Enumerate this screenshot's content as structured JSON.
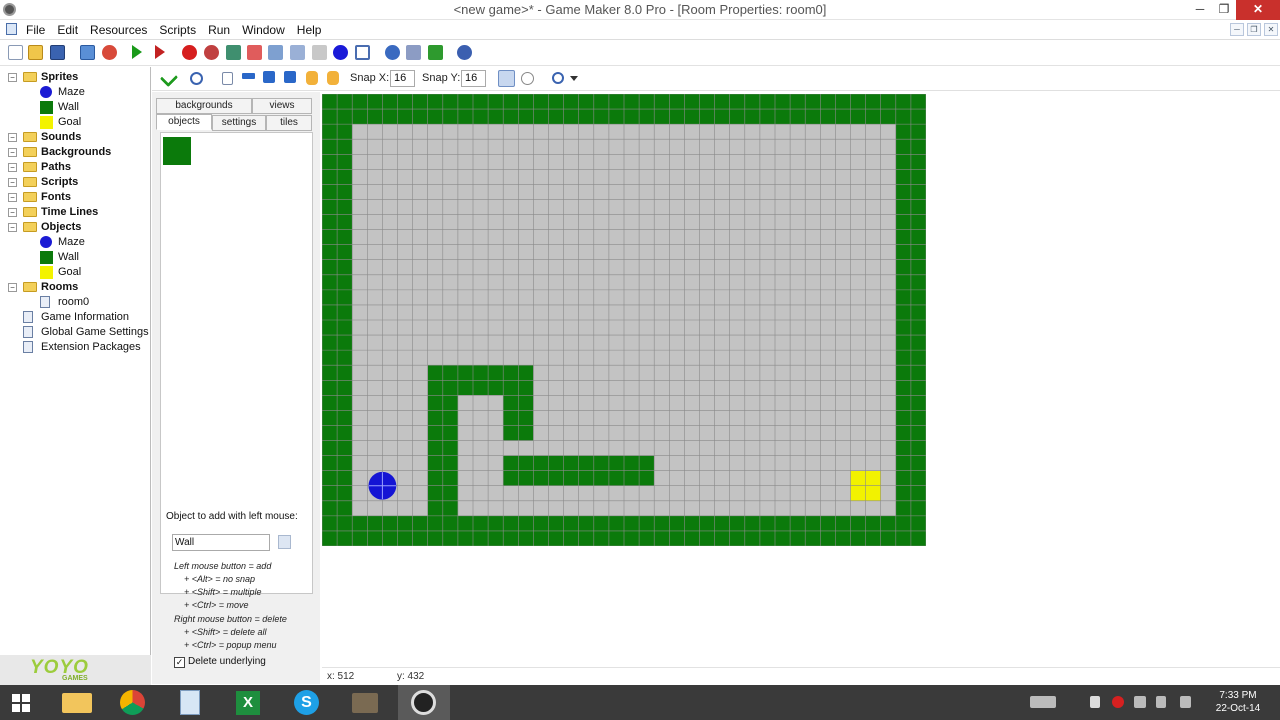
{
  "window": {
    "title": "<new game>* - Game Maker 8.0 Pro - [Room Properties: room0]"
  },
  "menu": [
    "File",
    "Edit",
    "Resources",
    "Scripts",
    "Run",
    "Window",
    "Help"
  ],
  "tree": {
    "items": [
      {
        "label": "Sprites",
        "kind": "folder",
        "bold": true,
        "indent": 0
      },
      {
        "label": "Maze",
        "kind": "circle",
        "indent": 1
      },
      {
        "label": "Wall",
        "kind": "green",
        "indent": 1
      },
      {
        "label": "Goal",
        "kind": "yellow",
        "indent": 1
      },
      {
        "label": "Sounds",
        "kind": "folder",
        "bold": true,
        "indent": 0
      },
      {
        "label": "Backgrounds",
        "kind": "folder",
        "bold": true,
        "indent": 0
      },
      {
        "label": "Paths",
        "kind": "folder",
        "bold": true,
        "indent": 0
      },
      {
        "label": "Scripts",
        "kind": "folder",
        "bold": true,
        "indent": 0
      },
      {
        "label": "Fonts",
        "kind": "folder",
        "bold": true,
        "indent": 0
      },
      {
        "label": "Time Lines",
        "kind": "folder",
        "bold": true,
        "indent": 0
      },
      {
        "label": "Objects",
        "kind": "folder",
        "bold": true,
        "indent": 0
      },
      {
        "label": "Maze",
        "kind": "circle",
        "indent": 1
      },
      {
        "label": "Wall",
        "kind": "green",
        "indent": 1
      },
      {
        "label": "Goal",
        "kind": "yellow",
        "indent": 1
      },
      {
        "label": "Rooms",
        "kind": "folder",
        "bold": true,
        "indent": 0
      },
      {
        "label": "room0",
        "kind": "doc",
        "indent": 1
      },
      {
        "label": "Game Information",
        "kind": "doc",
        "indent": 0
      },
      {
        "label": "Global Game Settings",
        "kind": "doc",
        "indent": 0
      },
      {
        "label": "Extension Packages",
        "kind": "doc",
        "indent": 0
      }
    ]
  },
  "logo": {
    "main": "YOYO",
    "sub": "GAMES"
  },
  "roomToolbar": {
    "snap_x_label": "Snap X:",
    "snap_x_value": "16",
    "snap_y_label": "Snap Y:",
    "snap_y_value": "16"
  },
  "tabs": {
    "backgrounds": "backgrounds",
    "views": "views",
    "objects": "objects",
    "settings": "settings",
    "tiles": "tiles"
  },
  "panel": {
    "add_label": "Object to add with left mouse:",
    "object_value": "Wall",
    "help_lines": [
      "Left mouse button = add",
      "+ <Alt> = no snap",
      "+ <Shift> = multiple",
      "+ <Ctrl> = move",
      "Right mouse button = delete",
      "+ <Shift> = delete all",
      "+ <Ctrl> = popup menu"
    ],
    "delete_underlying": "Delete underlying",
    "delete_checked": true
  },
  "room": {
    "cols": 40,
    "rows": 30,
    "colors": {
      "wall": "#0b7a0b",
      "floor": "#c3c3c3",
      "grid": "#8a8a8a",
      "player": "#1414d4",
      "goal": "#f2f200"
    },
    "walls": [
      [
        0,
        0,
        40,
        2
      ],
      [
        0,
        28,
        40,
        2
      ],
      [
        0,
        2,
        2,
        26
      ],
      [
        38,
        2,
        2,
        26
      ],
      [
        7,
        18,
        7,
        2
      ],
      [
        7,
        20,
        2,
        8
      ],
      [
        12,
        20,
        2,
        3
      ],
      [
        12,
        24,
        10,
        2
      ]
    ],
    "player": {
      "col": 3,
      "row": 25
    },
    "goal": {
      "col": 35,
      "row": 25
    }
  },
  "status": {
    "x": "x: 512",
    "y": "y: 432"
  },
  "clock": {
    "time": "7:33 PM",
    "date": "22-Oct-14"
  }
}
